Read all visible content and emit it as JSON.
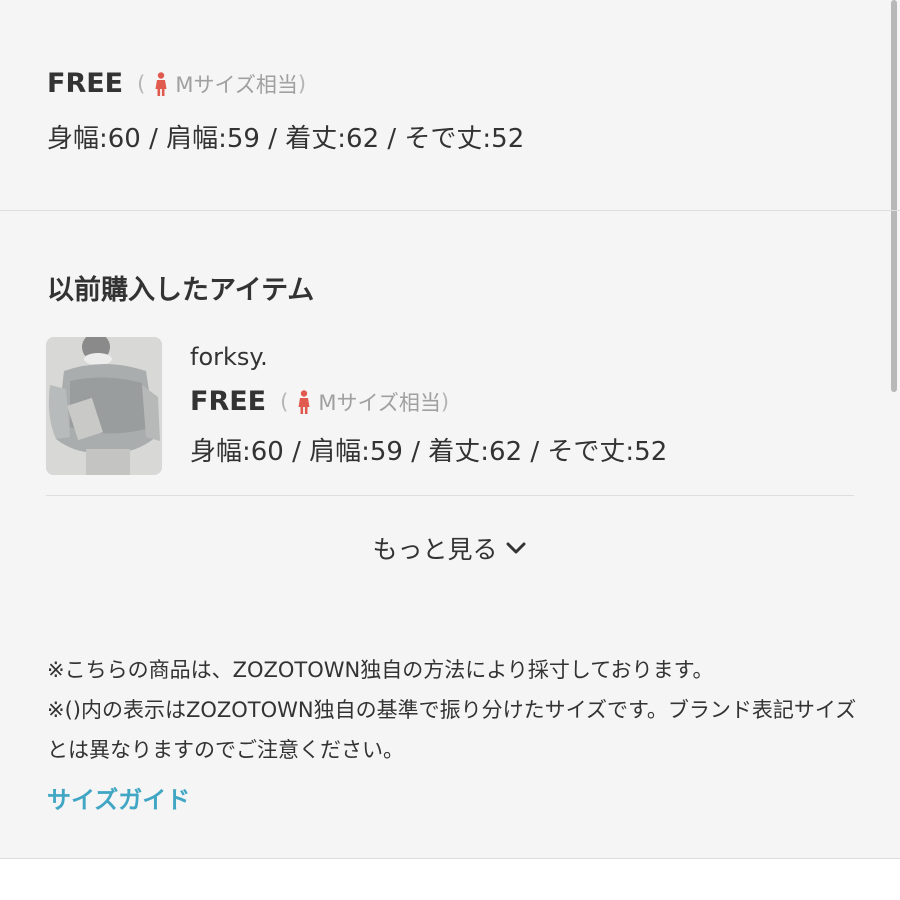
{
  "top_item": {
    "size_label": "FREE",
    "paren_open": "(",
    "size_equiv": "Mサイズ相当",
    "paren_close": ")",
    "measurements": "身幅:60 / 肩幅:59 / 着丈:62 / そで丈:52"
  },
  "previous": {
    "title": "以前購入したアイテム",
    "items": [
      {
        "brand": "forksy.",
        "size_label": "FREE",
        "paren_open": "(",
        "size_equiv": "Mサイズ相当",
        "paren_close": ")",
        "measurements": "身幅:60 / 肩幅:59 / 着丈:62 / そで丈:52"
      }
    ],
    "more_label": "もっと見る"
  },
  "notes": [
    "※こちらの商品は、ZOZOTOWN独自の方法により採寸しております。",
    "※()内の表示はZOZOTOWN独自の基準で振り分けたサイズです。ブランド表記サイズとは異なりますのでご注意ください。"
  ],
  "size_guide_link": "サイズガイド",
  "colors": {
    "accent_link": "#41a6c4",
    "person_icon": "#e05a4e",
    "background": "#f5f5f5"
  },
  "icons": {
    "size_person": "person-icon",
    "more": "chevron-down-icon"
  }
}
